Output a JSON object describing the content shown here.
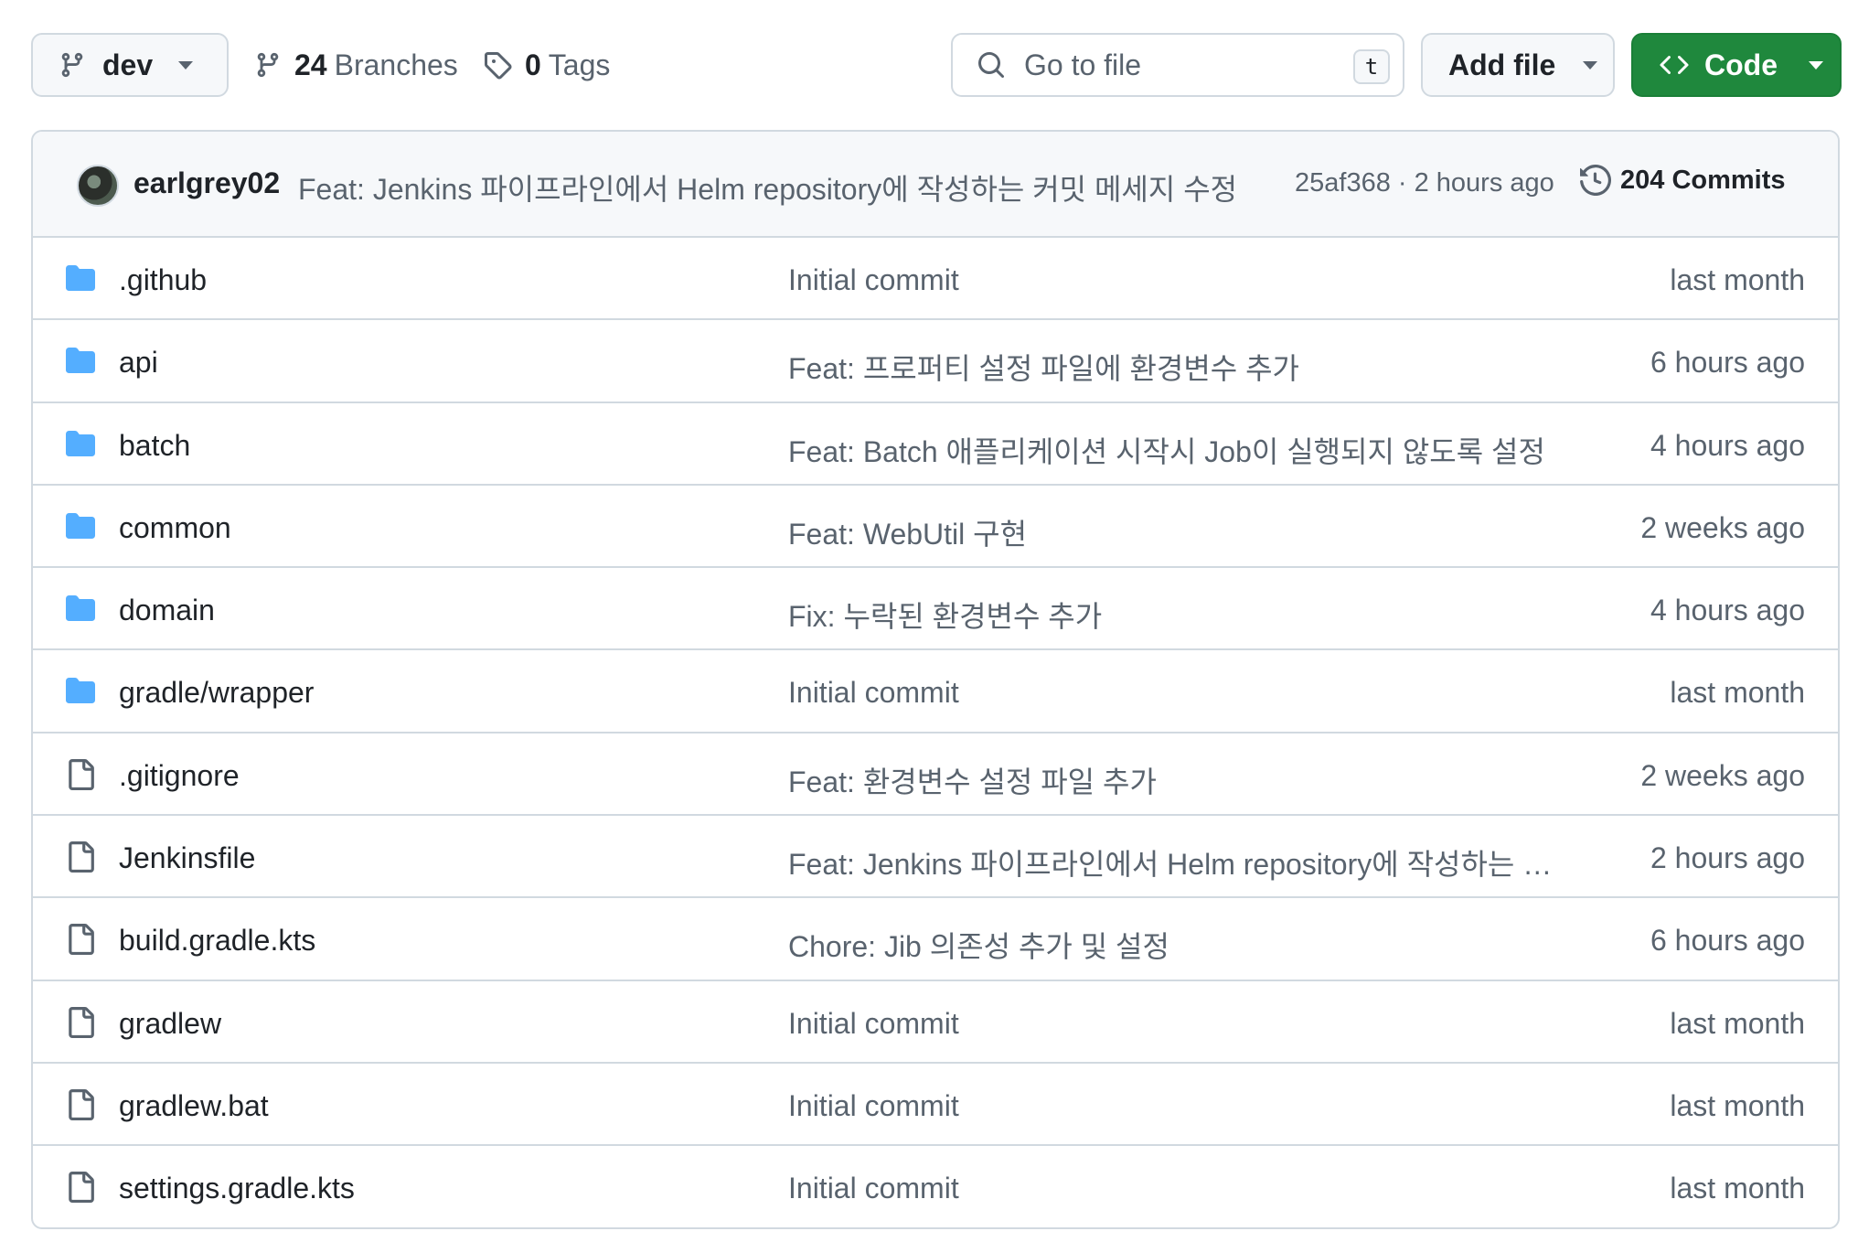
{
  "toolbar": {
    "branch": "dev",
    "branches_count": "24",
    "branches_label": "Branches",
    "tags_count": "0",
    "tags_label": "Tags",
    "search_placeholder": "Go to file",
    "search_shortcut": "t",
    "add_file_label": "Add file",
    "code_label": "Code"
  },
  "latest_commit": {
    "author": "earlgrey02",
    "message": "Feat: Jenkins 파이프라인에서 Helm repository에 작성하는 커밋 메세지 수정",
    "hash_time": "25af368 · 2 hours ago",
    "commits_label": "204 Commits"
  },
  "files": [
    {
      "name": ".github",
      "type": "folder",
      "message": "Initial commit",
      "age": "last month"
    },
    {
      "name": "api",
      "type": "folder",
      "message": "Feat: 프로퍼티 설정 파일에 환경변수 추가",
      "age": "6 hours ago"
    },
    {
      "name": "batch",
      "type": "folder",
      "message": "Feat: Batch 애플리케이션 시작시 Job이 실행되지 않도록 설정",
      "age": "4 hours ago"
    },
    {
      "name": "common",
      "type": "folder",
      "message": "Feat: WebUtil 구현",
      "age": "2 weeks ago"
    },
    {
      "name": "domain",
      "type": "folder",
      "message": "Fix: 누락된 환경변수 추가",
      "age": "4 hours ago"
    },
    {
      "name": "gradle/wrapper",
      "type": "folder",
      "message": "Initial commit",
      "age": "last month"
    },
    {
      "name": ".gitignore",
      "type": "file",
      "message": "Feat: 환경변수 설정 파일 추가",
      "age": "2 weeks ago"
    },
    {
      "name": "Jenkinsfile",
      "type": "file",
      "message": "Feat: Jenkins 파이프라인에서 Helm repository에 작성하는 커밋...",
      "age": "2 hours ago"
    },
    {
      "name": "build.gradle.kts",
      "type": "file",
      "message": "Chore: Jib 의존성 추가 및 설정",
      "age": "6 hours ago"
    },
    {
      "name": "gradlew",
      "type": "file",
      "message": "Initial commit",
      "age": "last month"
    },
    {
      "name": "gradlew.bat",
      "type": "file",
      "message": "Initial commit",
      "age": "last month"
    },
    {
      "name": "settings.gradle.kts",
      "type": "file",
      "message": "Initial commit",
      "age": "last month"
    }
  ],
  "colors": {
    "folder_icon": "#54aeff",
    "file_icon": "#59636e",
    "primary_green": "#1f883d",
    "border": "#d1d9e0",
    "muted_text": "#59636e"
  },
  "icons": {
    "branch": "git-branch-icon",
    "tag": "tag-icon",
    "search": "search-icon",
    "code": "code-icon",
    "history": "history-icon",
    "folder": "folder-icon",
    "file": "file-icon"
  }
}
